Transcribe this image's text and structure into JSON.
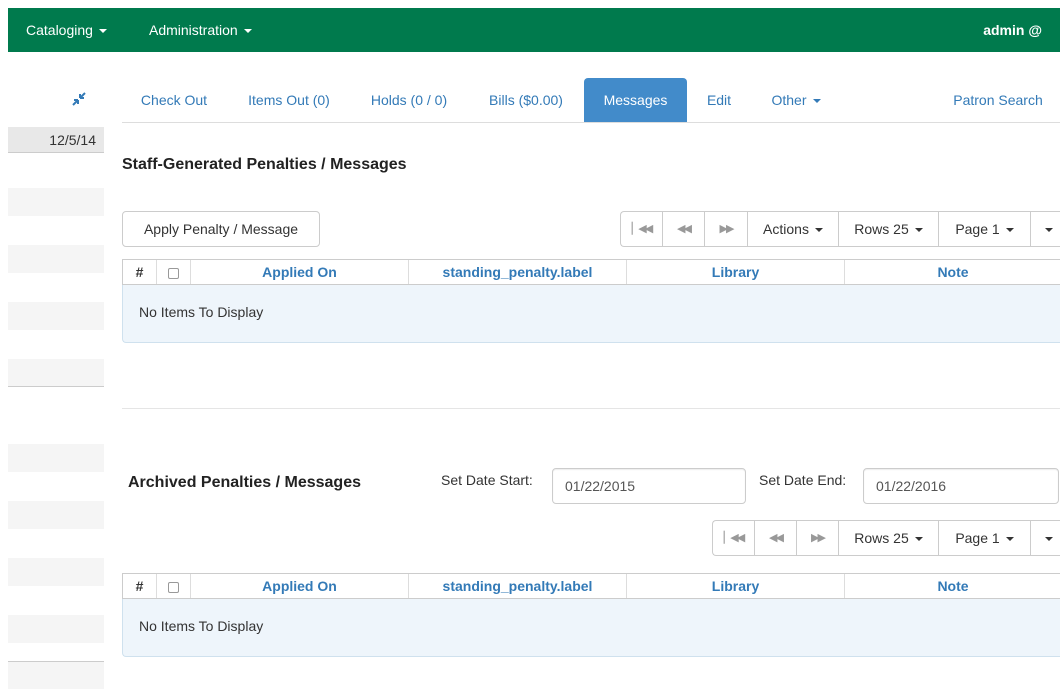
{
  "navbar": {
    "cataloging": "Cataloging",
    "administration": "Administration",
    "user": "admin @"
  },
  "sidebar": {
    "collapse_icon": "collapse-arrows-icon",
    "date": "12/5/14"
  },
  "tabs": {
    "check_out": "Check Out",
    "items_out": "Items Out (0)",
    "holds": "Holds (0 / 0)",
    "bills": "Bills ($0.00)",
    "messages": "Messages",
    "edit": "Edit",
    "other": "Other",
    "patron_search": "Patron Search",
    "active": "Messages"
  },
  "staff_section": {
    "title": "Staff-Generated Penalties / Messages",
    "apply_button": "Apply Penalty / Message",
    "toolbar": {
      "first_icon": "first-page-icon",
      "prev_icon": "previous-page-icon",
      "next_icon": "next-page-icon",
      "actions": "Actions",
      "rows": "Rows 25",
      "page": "Page 1"
    },
    "columns": [
      "#",
      "Applied On",
      "standing_penalty.label",
      "Library",
      "Note"
    ],
    "empty_text": "No Items To Display"
  },
  "archived_section": {
    "title": "Archived Penalties / Messages",
    "start_label": "Set Date Start:",
    "start_value": "01/22/2015",
    "end_label": "Set Date End:",
    "end_value": "01/22/2016",
    "toolbar": {
      "first_icon": "first-page-icon",
      "prev_icon": "previous-page-icon",
      "next_icon": "next-page-icon",
      "rows": "Rows 25",
      "page": "Page 1"
    },
    "columns": [
      "#",
      "Applied On",
      "standing_penalty.label",
      "Library",
      "Note"
    ],
    "empty_text": "No Items To Display"
  },
  "colors": {
    "navbar": "#007a4d",
    "link": "#337ab7",
    "active_tab": "#428bca",
    "empty_row": "#eef5fb"
  }
}
